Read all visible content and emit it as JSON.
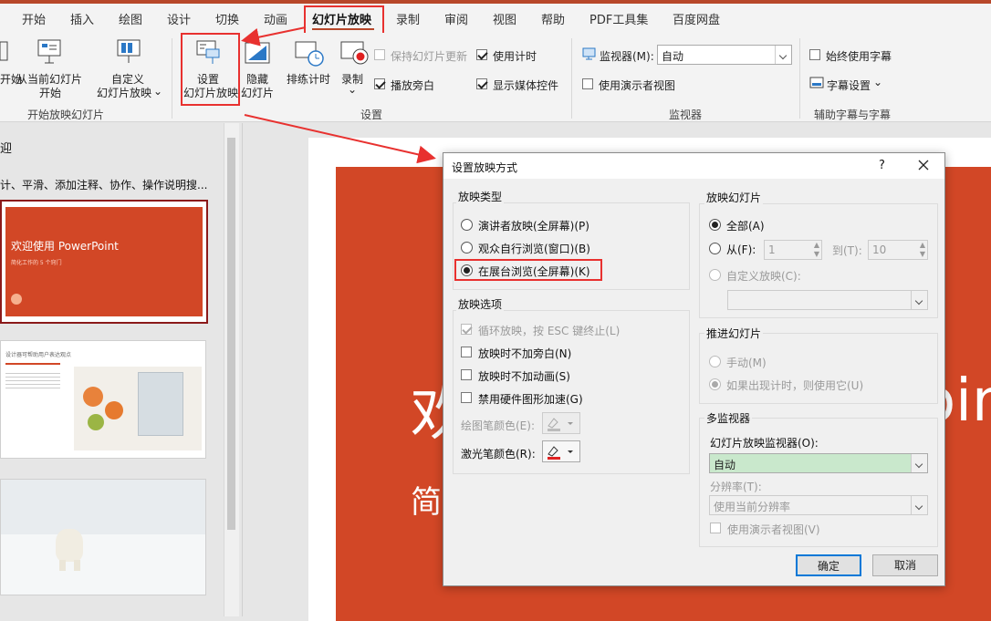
{
  "tabs": [
    {
      "label": "开始"
    },
    {
      "label": "插入"
    },
    {
      "label": "绘图"
    },
    {
      "label": "设计"
    },
    {
      "label": "切换"
    },
    {
      "label": "动画"
    },
    {
      "label": "幻灯片放映"
    },
    {
      "label": "录制"
    },
    {
      "label": "审阅"
    },
    {
      "label": "视图"
    },
    {
      "label": "帮助"
    },
    {
      "label": "PDF工具集"
    },
    {
      "label": "百度网盘"
    }
  ],
  "ribbon": {
    "start_group": {
      "from_begin_partial": "开始",
      "from_current_l1": "从当前幻灯片",
      "from_current_l2": "开始",
      "custom_l1": "自定义",
      "custom_l2": "幻灯片放映",
      "group_label": "开始放映幻灯片"
    },
    "setup_group": {
      "setup_l1": "设置",
      "setup_l2": "幻灯片放映",
      "hide_l1": "隐藏",
      "hide_l2": "幻灯片",
      "rehearse": "排练计时",
      "record": "录制",
      "keep_updated": "保持幻灯片更新",
      "play_narration": "播放旁白",
      "use_timings": "使用计时",
      "show_media": "显示媒体控件",
      "group_label": "设置"
    },
    "monitor_group": {
      "monitor_label": "监视器(M):",
      "monitor_value": "自动",
      "presenter_view": "使用演示者视图",
      "group_label": "监视器"
    },
    "caption_group": {
      "always_captions": "始终使用字幕",
      "caption_settings": "字幕设置",
      "group_label": "辅助字幕与字幕"
    }
  },
  "left_pane": {
    "outline_partial": "迎",
    "desc_partial": "计、平滑、添加注释、协作、操作说明搜...",
    "slide1_title": "欢迎使用 PowerPoint",
    "slide1_sub": "简化工作的 5 个窍门",
    "slide2_title": "设计器可帮助用户表达观点"
  },
  "canvas": {
    "big_left": "欢",
    "big_right": "oin",
    "sub_left": "简"
  },
  "dialog": {
    "title": "设置放映方式",
    "help": "?",
    "show_type": {
      "legend": "放映类型",
      "opt1": "演讲者放映(全屏幕)(P)",
      "opt2": "观众自行浏览(窗口)(B)",
      "opt3": "在展台浏览(全屏幕)(K)"
    },
    "show_options": {
      "legend": "放映选项",
      "loop": "循环放映，按 ESC 键终止(L)",
      "no_narration": "放映时不加旁白(N)",
      "no_animation": "放映时不加动画(S)",
      "no_hw_accel": "禁用硬件图形加速(G)",
      "pen_color": "绘图笔颜色(E):",
      "laser_color": "激光笔颜色(R):"
    },
    "show_slides": {
      "legend": "放映幻灯片",
      "all": "全部(A)",
      "from": "从(F):",
      "from_value": "1",
      "to": "到(T):",
      "to_value": "10",
      "custom": "自定义放映(C):"
    },
    "advance": {
      "legend": "推进幻灯片",
      "manual": "手动(M)",
      "timings": "如果出现计时，则使用它(U)"
    },
    "multi_monitor": {
      "legend": "多监视器",
      "monitor_label": "幻灯片放映监视器(O):",
      "monitor_value": "自动",
      "resolution_label": "分辨率(T):",
      "resolution_value": "使用当前分辨率",
      "presenter": "使用演示者视图(V)"
    },
    "ok": "确定",
    "cancel": "取消"
  },
  "colors": {
    "accent": "#b7472a",
    "slide_bg": "#d24726",
    "highlight": "#e8312f",
    "laser": "#e02020"
  }
}
